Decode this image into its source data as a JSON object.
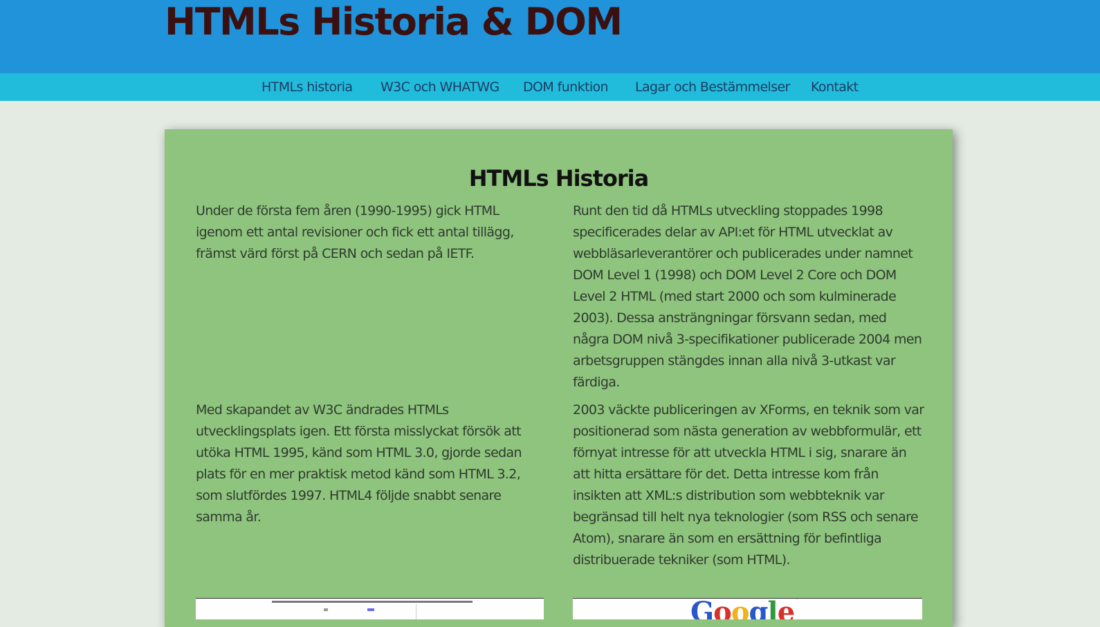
{
  "header": {
    "title": "HTMLs Historia & DOM"
  },
  "nav": {
    "items": [
      {
        "label": "HTMLs historia"
      },
      {
        "label": "W3C och WHATWG"
      },
      {
        "label": "DOM funktion"
      },
      {
        "label": "Lagar och Bestämmelser"
      },
      {
        "label": "Kontakt"
      }
    ]
  },
  "main": {
    "heading": "HTMLs Historia",
    "paragraphs": [
      "Under de första fem åren (1990-1995) gick HTML igenom ett antal revisioner och fick ett antal tillägg, främst värd först på CERN och sedan på IETF.",
      "Runt den tid då HTMLs utveckling stoppades 1998 specificerades delar av API:et för HTML utvecklat av webbläsarleverantörer och publicerades under namnet DOM Level 1 (1998) och DOM Level 2 Core och DOM Level 2 HTML (med start 2000 och som kulminerade 2003). Dessa ansträngningar försvann sedan, med några DOM nivå 3-specifikationer publicerade 2004 men arbetsgruppen stängdes innan alla nivå 3-utkast var färdiga.",
      "Med skapandet av W3C ändrades HTMLs utvecklingsplats igen. Ett första misslyckat försök att utöka HTML 1995, känd som HTML 3.0, gjorde sedan plats för en mer praktisk metod känd som HTML 3.2, som slutfördes 1997. HTML4 följde snabbt senare samma år.",
      "2003 väckte publiceringen av XForms, en teknik som var positionerad som nästa generation av webbformulär, ett förnyat intresse för att utveckla HTML i sig, snarare än att hitta ersättare för det. Detta intresse kom från insikten att XML:s distribution som webbteknik var begränsad till helt nya teknologier (som RSS och senare Atom), snarare än som en ersättning för befintliga distribuerade tekniker (som HTML)."
    ]
  },
  "images": {
    "right_logo": {
      "letters": [
        "G",
        "o",
        "o",
        "g",
        "l",
        "e"
      ],
      "trademark": "™"
    }
  }
}
